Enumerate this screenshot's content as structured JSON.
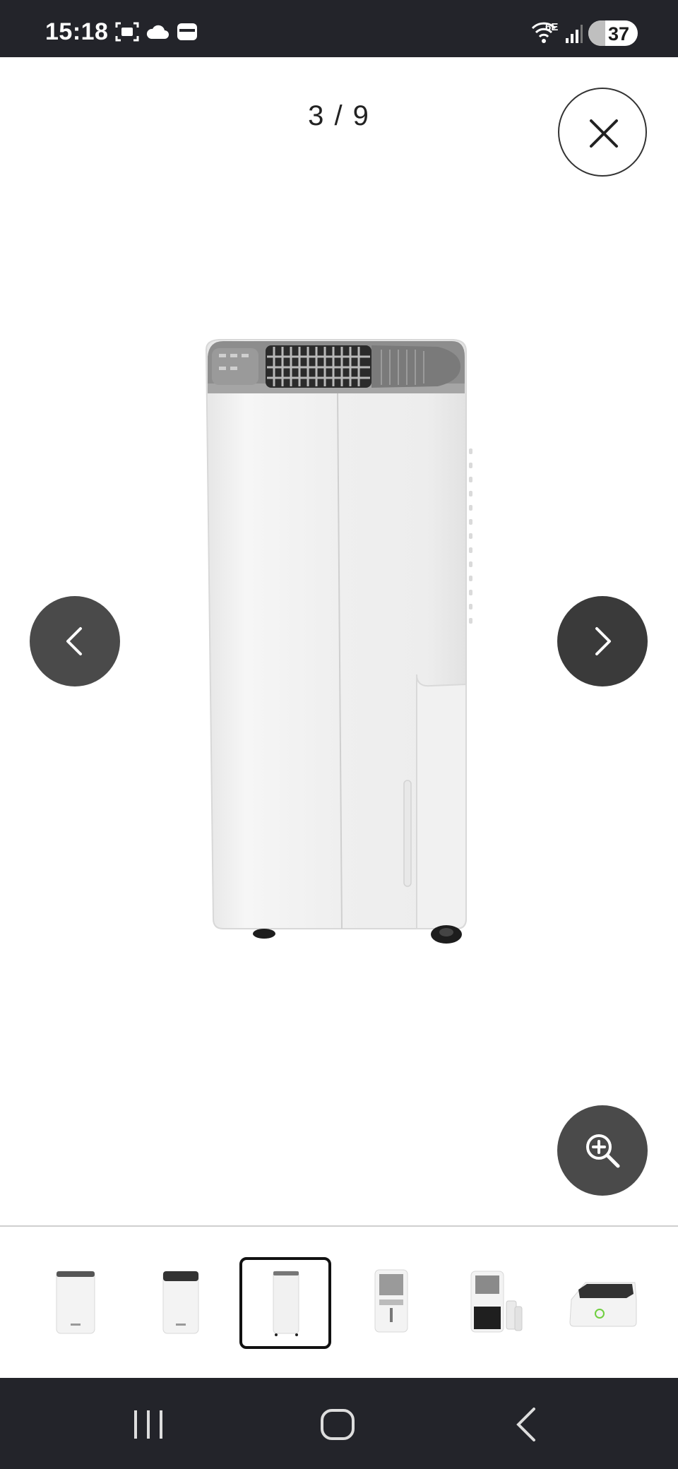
{
  "status_bar": {
    "time": "15:18",
    "network": "6E",
    "battery": "37",
    "icons": [
      "screenshot-icon",
      "cloud-icon",
      "wallet-icon",
      "wifi-icon",
      "signal-icon",
      "battery-icon"
    ]
  },
  "gallery": {
    "counter": "3 / 9",
    "current_index": 3,
    "total": 9,
    "icons": {
      "close": "close-icon",
      "prev": "chevron-left-icon",
      "next": "chevron-right-icon",
      "zoom": "zoom-in-icon"
    },
    "thumbnails": [
      {
        "selected": false,
        "kind": "front view"
      },
      {
        "selected": false,
        "kind": "angled view"
      },
      {
        "selected": true,
        "kind": "side view"
      },
      {
        "selected": false,
        "kind": "back view"
      },
      {
        "selected": false,
        "kind": "with tank removed"
      },
      {
        "selected": false,
        "kind": "top panel"
      }
    ]
  },
  "colors": {
    "bar_dark": "#23242a",
    "button_dark": "#4a4a4a",
    "accent_thumb_border": "#111111"
  },
  "nav_bar": {
    "icons": [
      "recent-apps-icon",
      "home-icon",
      "back-icon"
    ]
  }
}
